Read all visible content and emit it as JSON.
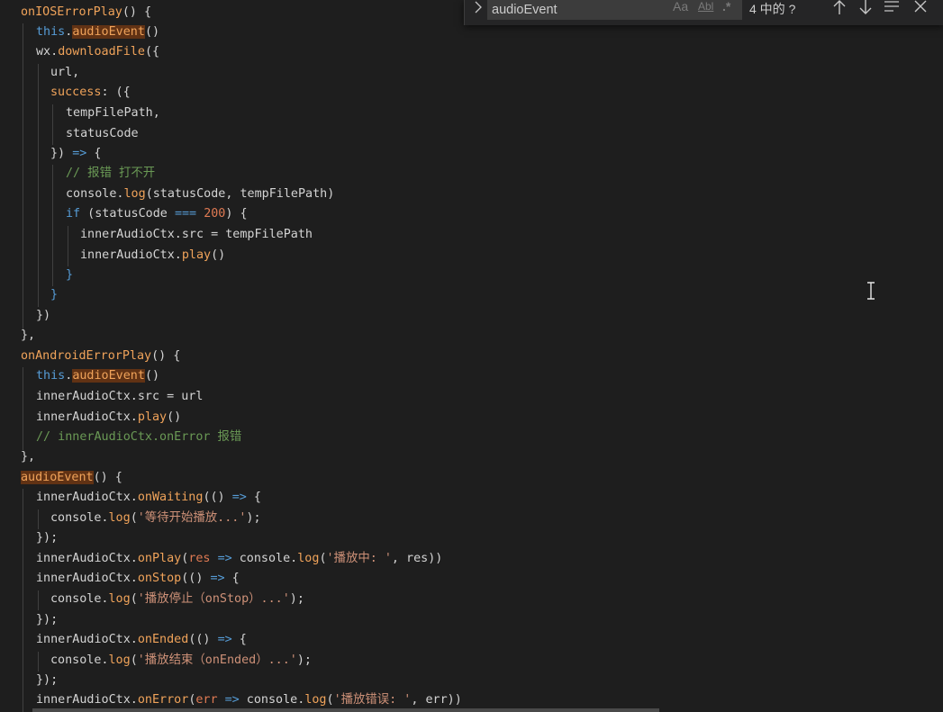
{
  "find": {
    "query": "audioEvent",
    "toggle_icon": "chevron-right-icon",
    "match_case_label": "Aa",
    "whole_word_label": "Abl",
    "regex_label": ".*",
    "match_count": "4 中的 ?",
    "prev_icon": "arrow-up-icon",
    "next_icon": "arrow-down-icon",
    "selection_icon": "find-in-selection-icon",
    "close_icon": "close-icon"
  },
  "code": {
    "l01": {
      "name": "onIOSErrorPlay",
      "rest": "() {"
    },
    "l02": {
      "this": "this",
      "dot": ".",
      "call": "audioEvent",
      "rest": "()"
    },
    "l03": {
      "obj": "wx.",
      "call": "downloadFile",
      "rest": "({"
    },
    "l04": {
      "text": "url,"
    },
    "l05": {
      "key": "success",
      "rest": ": ({"
    },
    "l06": {
      "text": "tempFilePath,"
    },
    "l07": {
      "text": "statusCode"
    },
    "l08": {
      "pre": "}) ",
      "arrow": "=>",
      "post": " {"
    },
    "l09": {
      "comment": "// 报错 打不开"
    },
    "l10": {
      "obj": "console.",
      "call": "log",
      "rest": "(statusCode, tempFilePath)"
    },
    "l11": {
      "kw": "if",
      "pre": " (statusCode ",
      "op": "===",
      "sp": " ",
      "num": "200",
      "post": ") {"
    },
    "l12": {
      "text": "innerAudioCtx.src = tempFilePath"
    },
    "l13": {
      "obj": "innerAudioCtx.",
      "call": "play",
      "rest": "()"
    },
    "l14": {
      "text": "}"
    },
    "l15": {
      "text": "}"
    },
    "l16": {
      "text": "})"
    },
    "l17": {
      "text": "},"
    },
    "l18": {
      "name": "onAndroidErrorPlay",
      "rest": "() {"
    },
    "l19": {
      "this": "this",
      "dot": ".",
      "call": "audioEvent",
      "rest": "()"
    },
    "l20": {
      "text": "innerAudioCtx.src = url"
    },
    "l21": {
      "obj": "innerAudioCtx.",
      "call": "play",
      "rest": "()"
    },
    "l22": {
      "comment": "// innerAudioCtx.onError 报错"
    },
    "l23": {
      "text": "},"
    },
    "l24": {
      "name": "audioEvent",
      "rest": "() {"
    },
    "l25": {
      "obj": "innerAudioCtx.",
      "call": "onWaiting",
      "pre": "(() ",
      "arrow": "=>",
      "post": " {"
    },
    "l26": {
      "obj": "console.",
      "call": "log",
      "open": "(",
      "str": "'等待开始播放...'",
      "close": ");"
    },
    "l27": {
      "text": "});"
    },
    "l28": {
      "obj": "innerAudioCtx.",
      "call": "onPlay",
      "p1": "(",
      "param": "res",
      "sp": " ",
      "arrow": "=>",
      "p2": " console.",
      "call2": "log",
      "open": "(",
      "str": "'播放中: '",
      "close": ", res))"
    },
    "l29": {
      "obj": "innerAudioCtx.",
      "call": "onStop",
      "pre": "(() ",
      "arrow": "=>",
      "post": " {"
    },
    "l30": {
      "obj": "console.",
      "call": "log",
      "open": "(",
      "str": "'播放停止（onStop）...'",
      "close": ");"
    },
    "l31": {
      "text": "});"
    },
    "l32": {
      "obj": "innerAudioCtx.",
      "call": "onEnded",
      "pre": "(() ",
      "arrow": "=>",
      "post": " {"
    },
    "l33": {
      "obj": "console.",
      "call": "log",
      "open": "(",
      "str": "'播放结束（onEnded）...'",
      "close": ");"
    },
    "l34": {
      "text": "});"
    },
    "l35": {
      "obj": "innerAudioCtx.",
      "call": "onError",
      "p1": "(",
      "param": "err",
      "sp": " ",
      "arrow": "=>",
      "p2": " console.",
      "call2": "log",
      "open": "(",
      "str": "'播放错误: '",
      "close": ", err))"
    }
  },
  "colors": {
    "background": "#1e1e1e",
    "find_highlight": "#613214",
    "function": "#dcdcaa",
    "keyword": "#569cd6",
    "string": "#ce9178",
    "number": "#b5cea8",
    "comment": "#6a9955"
  }
}
